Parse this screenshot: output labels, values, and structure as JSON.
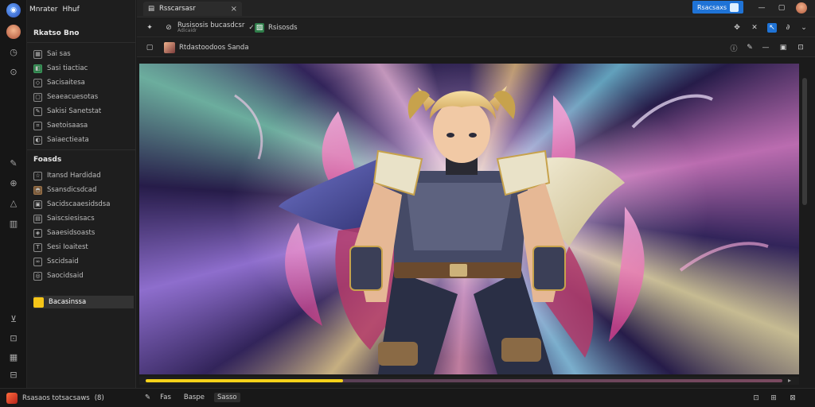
{
  "app": {
    "brand_name": "Mnrater",
    "brand_menu": "Hhuf",
    "workspace_label": "Rkatso Bno"
  },
  "sidebar": {
    "group1_items": [
      {
        "label": "Sai sas",
        "icon": "grid-icon"
      },
      {
        "label": "Sasi tiactiac",
        "icon": "layers-icon"
      },
      {
        "label": "Sacisaitesa",
        "icon": "tag-icon"
      },
      {
        "label": "Seaeacuesotas",
        "icon": "frame-icon"
      },
      {
        "label": "Sakisi Sanetstat",
        "icon": "brush-icon"
      },
      {
        "label": "Saetoisaasa",
        "icon": "crop-icon"
      },
      {
        "label": "Saiaectieata",
        "icon": "palette-icon"
      }
    ],
    "section2_title": "Foasds",
    "group2_items": [
      {
        "label": "Itansd Hardidad",
        "icon": "star-icon"
      },
      {
        "label": "Ssansdicsdcad",
        "icon": "user-icon"
      },
      {
        "label": "Sacidscaaesidsdsa",
        "icon": "image-icon"
      },
      {
        "label": "Saiscsiesisacs",
        "icon": "film-icon"
      },
      {
        "label": "Saaesidsoasts",
        "icon": "shape-icon"
      },
      {
        "label": "Sesi Ioaitest",
        "icon": "text-icon"
      },
      {
        "label": "Sscidsaid",
        "icon": "link-icon"
      },
      {
        "label": "Saocidsaid",
        "icon": "sticker-icon"
      },
      {
        "label": "Bacasinssa",
        "icon": "folder-icon",
        "active": true
      }
    ]
  },
  "tab": {
    "title": "Rsscarsasr",
    "close": "×"
  },
  "titlebar": {
    "primary_button": "Rsacsaxs"
  },
  "toolbar1": {
    "doc_name": "Rusisosis bucasdcsr",
    "doc_sub": "Adicaidr",
    "checkmark": "✓",
    "layer_name": "Rsisosds"
  },
  "toolbar2": {
    "file_name": "Rtdastoodoos Sanda"
  },
  "progress": {
    "value_pct": 31
  },
  "statusbar": {
    "project_label": "Rsasaos totsacsaws",
    "project_count": "(8)",
    "mode_1": "Fas",
    "mode_2": "Baspe",
    "mode_3": "Sasso"
  },
  "colors": {
    "accent": "#1f73d6",
    "highlight": "#f5c518"
  }
}
